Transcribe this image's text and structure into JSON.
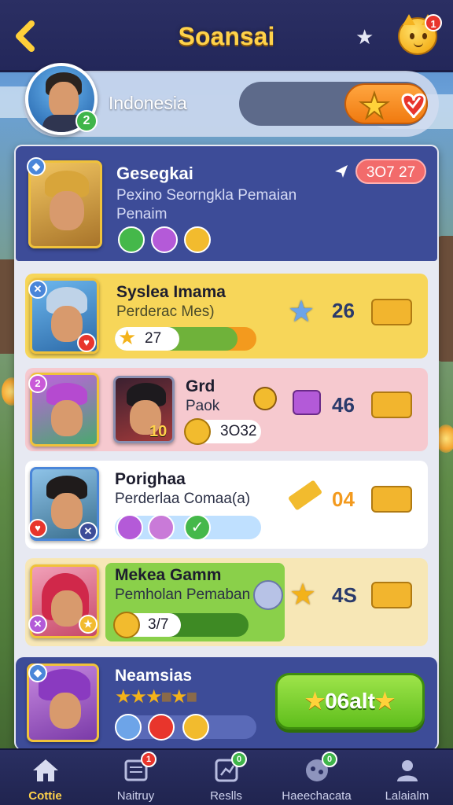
{
  "header": {
    "title": "Soansai",
    "cat_badge": "1"
  },
  "profile": {
    "region": "Indonesia",
    "level": "2"
  },
  "hero_card": {
    "name": "Gesegkai",
    "subtitle_line1": "Pexino Seorngkla Pemaian",
    "subtitle_line2": "Penaim",
    "score": "3O7 27"
  },
  "rows": [
    {
      "name": "Syslea Imama",
      "sub": "Perderac Mes)",
      "progress_label": "27",
      "count": "26",
      "bg": "#f7d659"
    },
    {
      "name": "Grd",
      "sub": "Paok",
      "coin_label": "3O32",
      "portrait_level": "10",
      "count": "46",
      "bg": "#f6c9cf"
    },
    {
      "name": "Porighaa",
      "sub": "Perderlaa Comaa(a)",
      "count": "04",
      "bg": "#ffffff"
    },
    {
      "name": "Mekea Gamm",
      "sub": "Pemholan Pemaban",
      "progress_label": "3/7",
      "count": "4S",
      "bg": "#f7e7b6"
    }
  ],
  "last_card": {
    "name": "Neamsias",
    "go_button": "06alt"
  },
  "bottom_nav": [
    {
      "label": "Cottie",
      "active": true,
      "icon": "home-icon"
    },
    {
      "label": "Naitruy",
      "badge": "1",
      "icon": "news-icon"
    },
    {
      "label": "Reslls",
      "badge": "0",
      "icon": "results-icon"
    },
    {
      "label": "Haeechacata",
      "badge": "0",
      "icon": "controller-icon"
    },
    {
      "label": "Lalaialm",
      "icon": "profile-icon"
    }
  ],
  "colors": {
    "topbar": "#2b2f63",
    "title_gold": "#ffd24a",
    "hero_card": "#3d4c98",
    "go_green": "#5fbe1c"
  }
}
